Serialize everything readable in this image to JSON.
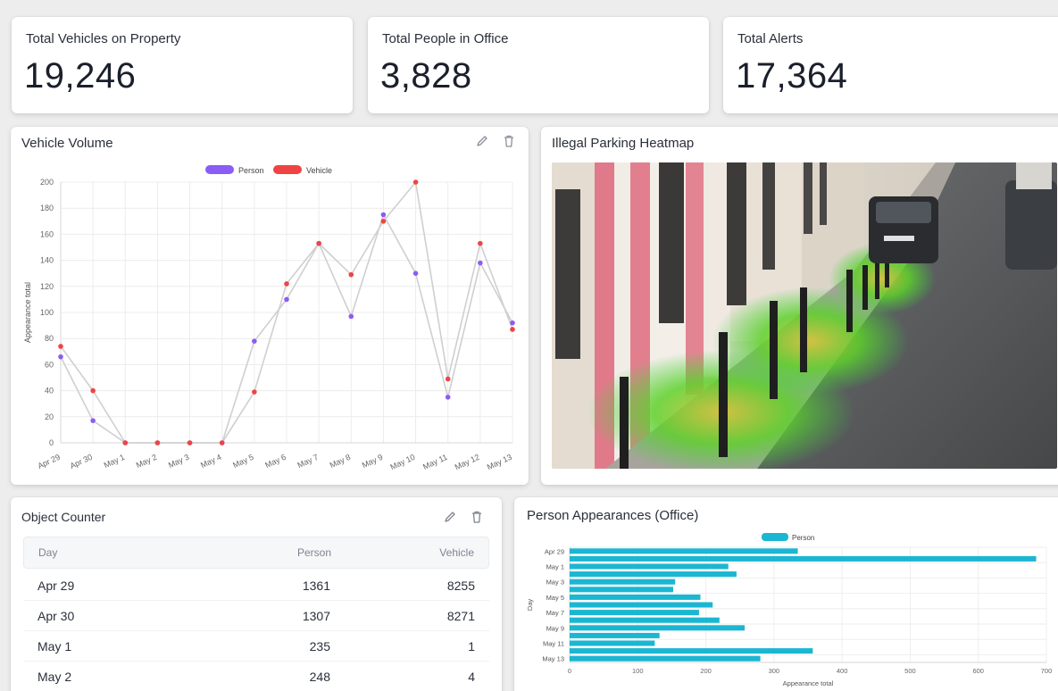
{
  "stats": {
    "vehicles": {
      "label": "Total Vehicles on Property",
      "value": "19,246"
    },
    "people": {
      "label": "Total People in Office",
      "value": "3,828"
    },
    "alerts": {
      "label": "Total Alerts",
      "value": "17,364"
    }
  },
  "vehicle_volume": {
    "title": "Vehicle Volume",
    "edit_icon": "pencil-icon",
    "delete_icon": "trash-icon"
  },
  "heatmap": {
    "title": "Illegal Parking Heatmap"
  },
  "object_counter": {
    "title": "Object Counter",
    "columns": [
      "Day",
      "Person",
      "Vehicle"
    ],
    "rows": [
      {
        "day": "Apr 29",
        "person": "1361",
        "vehicle": "8255"
      },
      {
        "day": "Apr 30",
        "person": "1307",
        "vehicle": "8271"
      },
      {
        "day": "May 1",
        "person": "235",
        "vehicle": "1"
      },
      {
        "day": "May 2",
        "person": "248",
        "vehicle": "4"
      }
    ]
  },
  "person_appearances": {
    "title": "Person Appearances (Office)"
  },
  "colors": {
    "person": "#8b5cf6",
    "vehicle": "#ef4444",
    "bar": "#1bb6d2"
  },
  "chart_data": [
    {
      "type": "line",
      "title": "Vehicle Volume",
      "xlabel": "",
      "ylabel": "Appearance total",
      "categories": [
        "Apr 29",
        "Apr 30",
        "May 1",
        "May 2",
        "May 3",
        "May 4",
        "May 5",
        "May 6",
        "May 7",
        "May 8",
        "May 9",
        "May 10",
        "May 11",
        "May 12",
        "May 13"
      ],
      "series": [
        {
          "name": "Person",
          "values": [
            66,
            17,
            0,
            0,
            0,
            0,
            78,
            110,
            153,
            97,
            175,
            130,
            35,
            138,
            92
          ]
        },
        {
          "name": "Vehicle",
          "values": [
            74,
            40,
            0,
            0,
            0,
            0,
            39,
            122,
            153,
            129,
            170,
            200,
            49,
            153,
            87
          ]
        }
      ],
      "ylim": [
        0,
        200
      ],
      "yticks": [
        0,
        20,
        40,
        60,
        80,
        100,
        120,
        140,
        160,
        180,
        200
      ],
      "grid": true,
      "legend": "top-center"
    },
    {
      "type": "bar",
      "orientation": "horizontal",
      "title": "Person Appearances (Office)",
      "xlabel": "Appearance total",
      "ylabel": "Day",
      "categories": [
        "Apr 29",
        "Apr 30",
        "May 1",
        "May 2",
        "May 3",
        "May 4",
        "May 5",
        "May 6",
        "May 7",
        "May 8",
        "May 9",
        "May 10",
        "May 11",
        "May 12",
        "May 13"
      ],
      "tick_labels": [
        "Apr 29",
        "May 1",
        "May 3",
        "May 5",
        "May 7",
        "May 9",
        "May 11",
        "May 13"
      ],
      "series": [
        {
          "name": "Person",
          "values": [
            335,
            685,
            233,
            245,
            155,
            152,
            192,
            210,
            190,
            220,
            257,
            132,
            125,
            357,
            280
          ]
        }
      ],
      "xlim": [
        0,
        700
      ],
      "xticks": [
        0,
        100,
        200,
        300,
        400,
        500,
        600,
        700
      ],
      "grid": true,
      "legend": "top-center"
    }
  ]
}
